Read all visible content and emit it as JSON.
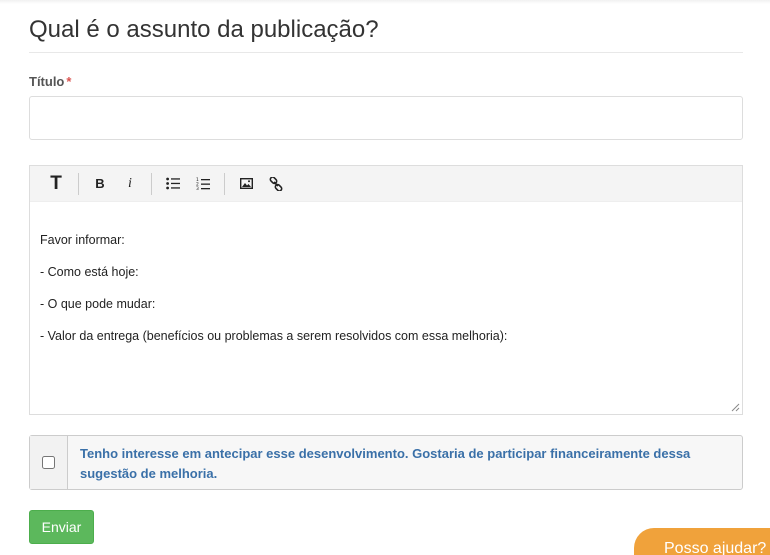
{
  "heading": "Qual é o assunto da publicação?",
  "title_field": {
    "label": "Título",
    "required_mark": "*",
    "value": "",
    "placeholder": ""
  },
  "editor": {
    "toolbar": {
      "heading_label": "T",
      "bold_label": "B",
      "italic_label": "i"
    },
    "lines": [
      "Favor informar:",
      "- Como está hoje:",
      "- O que pode mudar:",
      "- Valor da entrega (benefícios ou problemas a serem resolvidos com essa melhoria):"
    ]
  },
  "interest_checkbox": {
    "checked": false,
    "label": "Tenho interesse em antecipar esse desenvolvimento. Gostaria de participar financeiramente dessa sugestão de melhoria."
  },
  "submit_label": "Enviar",
  "help_chat_label": "Posso ajudar?",
  "colors": {
    "submit": "#5cb85c",
    "help_bubble": "#f0a23b",
    "checkbox_text": "#3a70a8",
    "required": "#d9534f"
  }
}
